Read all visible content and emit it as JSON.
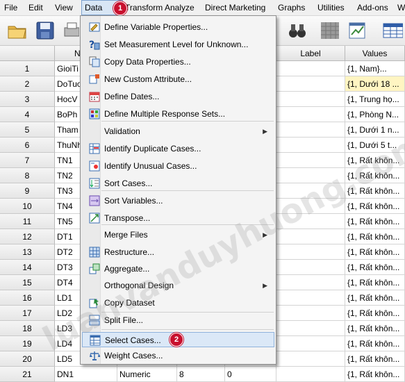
{
  "menubar": {
    "items": [
      "File",
      "Edit",
      "View",
      "Data",
      "Transform",
      "Analyze",
      "Direct Marketing",
      "Graphs",
      "Utilities",
      "Add-ons",
      "W"
    ],
    "active": "Data"
  },
  "badges": {
    "step1": "1",
    "step2": "2"
  },
  "grid": {
    "headers": {
      "name": "N",
      "label": "Label",
      "values": "Values"
    },
    "rows": [
      {
        "num": "1",
        "name": "GioiTi",
        "values": "{1, Nam}..."
      },
      {
        "num": "2",
        "name": "DoTuo",
        "values": "{1, Dưới 18 ..."
      },
      {
        "num": "3",
        "name": "HocV",
        "values": "{1, Trung họ..."
      },
      {
        "num": "4",
        "name": "BoPh",
        "values": "{1, Phòng N..."
      },
      {
        "num": "5",
        "name": "Tham",
        "values": "{1, Dưới 1 n..."
      },
      {
        "num": "6",
        "name": "ThuNh",
        "values": "{1, Dưới 5 t..."
      },
      {
        "num": "7",
        "name": "TN1",
        "values": "{1, Rất khôn..."
      },
      {
        "num": "8",
        "name": "TN2",
        "values": "{1, Rất khôn..."
      },
      {
        "num": "9",
        "name": "TN3",
        "values": "{1, Rất khôn..."
      },
      {
        "num": "10",
        "name": "TN4",
        "values": "{1, Rất khôn..."
      },
      {
        "num": "11",
        "name": "TN5",
        "values": "{1, Rất khôn..."
      },
      {
        "num": "12",
        "name": "DT1",
        "values": "{1, Rất khôn..."
      },
      {
        "num": "13",
        "name": "DT2",
        "values": "{1, Rất khôn..."
      },
      {
        "num": "14",
        "name": "DT3",
        "values": "{1, Rất khôn..."
      },
      {
        "num": "15",
        "name": "DT4",
        "values": "{1, Rất khôn..."
      },
      {
        "num": "16",
        "name": "LD1",
        "values": "{1, Rất khôn..."
      },
      {
        "num": "17",
        "name": "LD2",
        "values": "{1, Rất khôn..."
      },
      {
        "num": "18",
        "name": "LD3",
        "values": "{1, Rất khôn..."
      },
      {
        "num": "19",
        "name": "LD4",
        "values": "{1, Rất khôn..."
      },
      {
        "num": "20",
        "name": "LD5",
        "values": "{1, Rất khôn..."
      },
      {
        "num": "21",
        "name": "DN1",
        "type": "Numeric",
        "width": "8",
        "decimals": "0",
        "values": "{1, Rất khôn..."
      }
    ]
  },
  "data_menu": {
    "items": [
      {
        "label": "Define Variable Properties...",
        "icon": "define-variable-properties-icon"
      },
      {
        "label": "Set Measurement Level for Unknown...",
        "icon": "measurement-level-icon"
      },
      {
        "label": "Copy Data Properties...",
        "icon": "copy-data-properties-icon"
      },
      {
        "label": "New Custom Attribute...",
        "icon": "custom-attribute-icon"
      },
      {
        "label": "Define Dates...",
        "icon": "calendar-icon"
      },
      {
        "label": "Define Multiple Response Sets...",
        "icon": "multiple-response-icon"
      },
      {
        "label": "Validation",
        "icon": "",
        "submenu": true
      },
      {
        "label": "Identify Duplicate Cases...",
        "icon": "duplicate-cases-icon"
      },
      {
        "label": "Identify Unusual Cases...",
        "icon": "unusual-cases-icon"
      },
      {
        "label": "Sort Cases...",
        "icon": "sort-cases-icon"
      },
      {
        "label": "Sort Variables...",
        "icon": "sort-variables-icon"
      },
      {
        "label": "Transpose...",
        "icon": "transpose-icon"
      },
      {
        "label": "Merge Files",
        "icon": "",
        "submenu": true
      },
      {
        "label": "Restructure...",
        "icon": "restructure-icon"
      },
      {
        "label": "Aggregate...",
        "icon": "aggregate-icon"
      },
      {
        "label": "Orthogonal Design",
        "icon": "",
        "submenu": true
      },
      {
        "label": "Copy Dataset",
        "icon": "copy-dataset-icon"
      },
      {
        "label": "Split File...",
        "icon": "split-file-icon"
      },
      {
        "label": "Select Cases...",
        "icon": "select-cases-icon",
        "selected": true
      },
      {
        "label": "Weight Cases...",
        "icon": "weight-cases-icon"
      }
    ]
  },
  "watermark": {
    "text": "luanvanduyhuong.com"
  },
  "colors": {
    "badge": "#c8102e",
    "highlight": "#fff5c2",
    "menu_selected": "#dbe8f7"
  }
}
